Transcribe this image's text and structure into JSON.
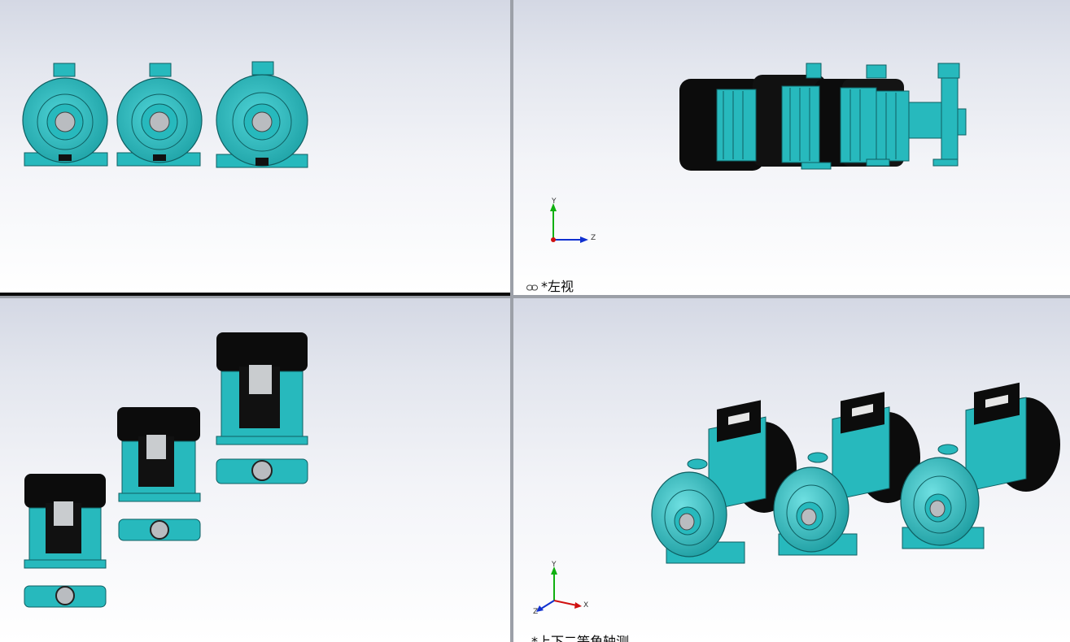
{
  "viewports": {
    "front": {
      "label": ""
    },
    "left": {
      "label": "*左视",
      "triad": {
        "axes": [
          "Y",
          "Z"
        ]
      }
    },
    "top": {
      "label": ""
    },
    "iso": {
      "label": "*上下二等角轴测",
      "triad": {
        "axes": [
          "Y",
          "X",
          "Z"
        ]
      }
    }
  },
  "pump_count_per_view": 3,
  "colors": {
    "pump_body": "#27b9bd",
    "pump_dark": "#0f6e72",
    "motor_cap": "#0c0c0c",
    "active_view_border": "#0b0b0b",
    "axis_x": "#d01010",
    "axis_y": "#10b010",
    "axis_z": "#1030d0"
  },
  "icons": [
    "link-icon",
    "coordinate-triad-icon"
  ]
}
